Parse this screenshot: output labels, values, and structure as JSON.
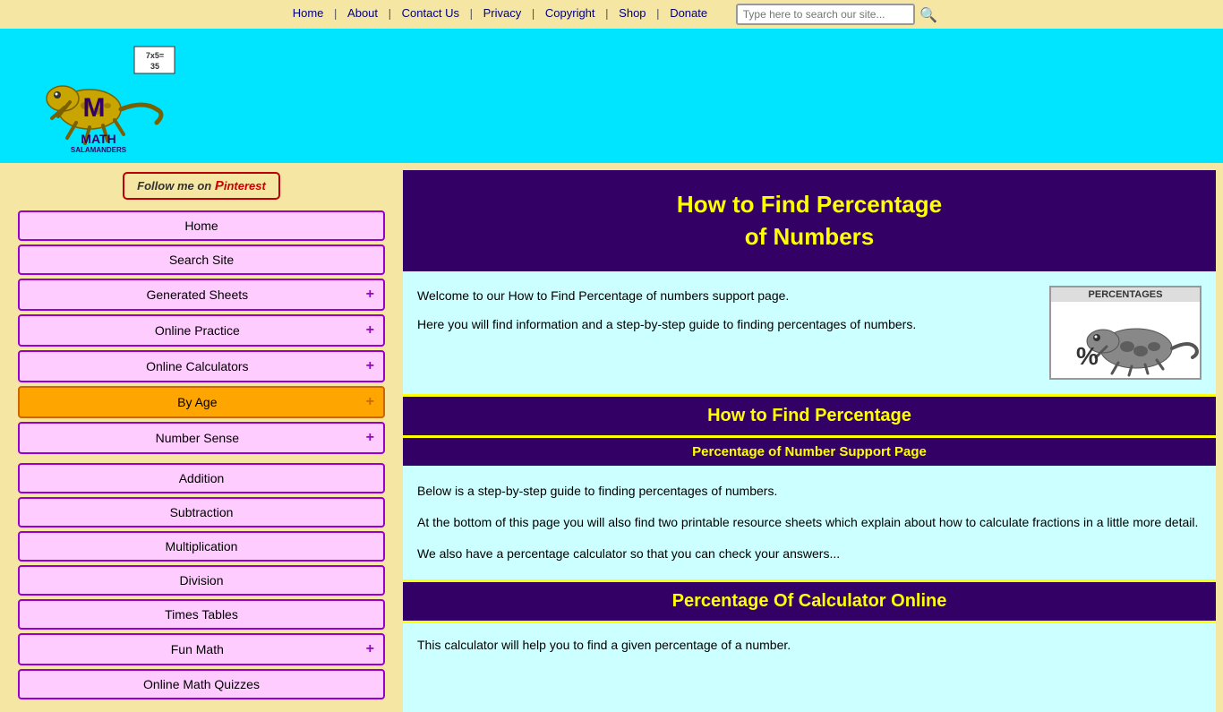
{
  "topnav": {
    "links": [
      {
        "label": "Home",
        "id": "nav-home"
      },
      {
        "label": "About",
        "id": "nav-about"
      },
      {
        "label": "Contact Us",
        "id": "nav-contact"
      },
      {
        "label": "Privacy",
        "id": "nav-privacy"
      },
      {
        "label": "Copyright",
        "id": "nav-copyright"
      },
      {
        "label": "Shop",
        "id": "nav-shop"
      },
      {
        "label": "Donate",
        "id": "nav-donate"
      }
    ],
    "search_placeholder": "Type here to search our site..."
  },
  "header": {
    "logo_text": "MATH\nSALAMANDERS"
  },
  "sidebar": {
    "pinterest_label": "Follow me on Pinterest",
    "nav_items": [
      {
        "label": "Home",
        "id": "nav-home-side",
        "has_plus": false,
        "active": false
      },
      {
        "label": "Search Site",
        "id": "nav-search-site",
        "has_plus": false,
        "active": false
      },
      {
        "label": "Generated Sheets",
        "id": "nav-generated",
        "has_plus": true,
        "active": false
      },
      {
        "label": "Online Practice",
        "id": "nav-online-practice",
        "has_plus": true,
        "active": false
      },
      {
        "label": "Online Calculators",
        "id": "nav-online-calc",
        "has_plus": true,
        "active": false
      },
      {
        "label": "By Age",
        "id": "nav-by-age",
        "has_plus": true,
        "active": true
      },
      {
        "label": "Number Sense",
        "id": "nav-number-sense",
        "has_plus": true,
        "active": false
      }
    ],
    "sub_items": [
      {
        "label": "Addition",
        "id": "nav-addition"
      },
      {
        "label": "Subtraction",
        "id": "nav-subtraction"
      },
      {
        "label": "Multiplication",
        "id": "nav-multiplication"
      },
      {
        "label": "Division",
        "id": "nav-division"
      },
      {
        "label": "Times Tables",
        "id": "nav-times-tables"
      },
      {
        "label": "Fun Math",
        "id": "nav-fun-math",
        "has_plus": true
      },
      {
        "label": "Online Math Quizzes",
        "id": "nav-quizzes"
      }
    ]
  },
  "content": {
    "page_title_line1": "How to Find Percentage",
    "page_title_line2": "of Numbers",
    "intro_p1": "Welcome to our How to Find Percentage of numbers support page.",
    "intro_p2": "Here you will find information and a step-by-step guide to finding percentages of numbers.",
    "image_label": "PERCENTAGES",
    "section1_title": "How to Find Percentage",
    "sub_section_title": "Percentage of Number Support Page",
    "step_p1": "Below is a step-by-step guide to finding percentages of numbers.",
    "step_p2": "At the bottom of this page you will also find two printable resource sheets which explain about how to calculate fractions in a little more detail.",
    "step_p3": "We also have a percentage calculator so that you can check your answers...",
    "calc_section_title": "Percentage Of Calculator Online",
    "calc_p1": "This calculator will help you to find a given percentage of a number."
  }
}
